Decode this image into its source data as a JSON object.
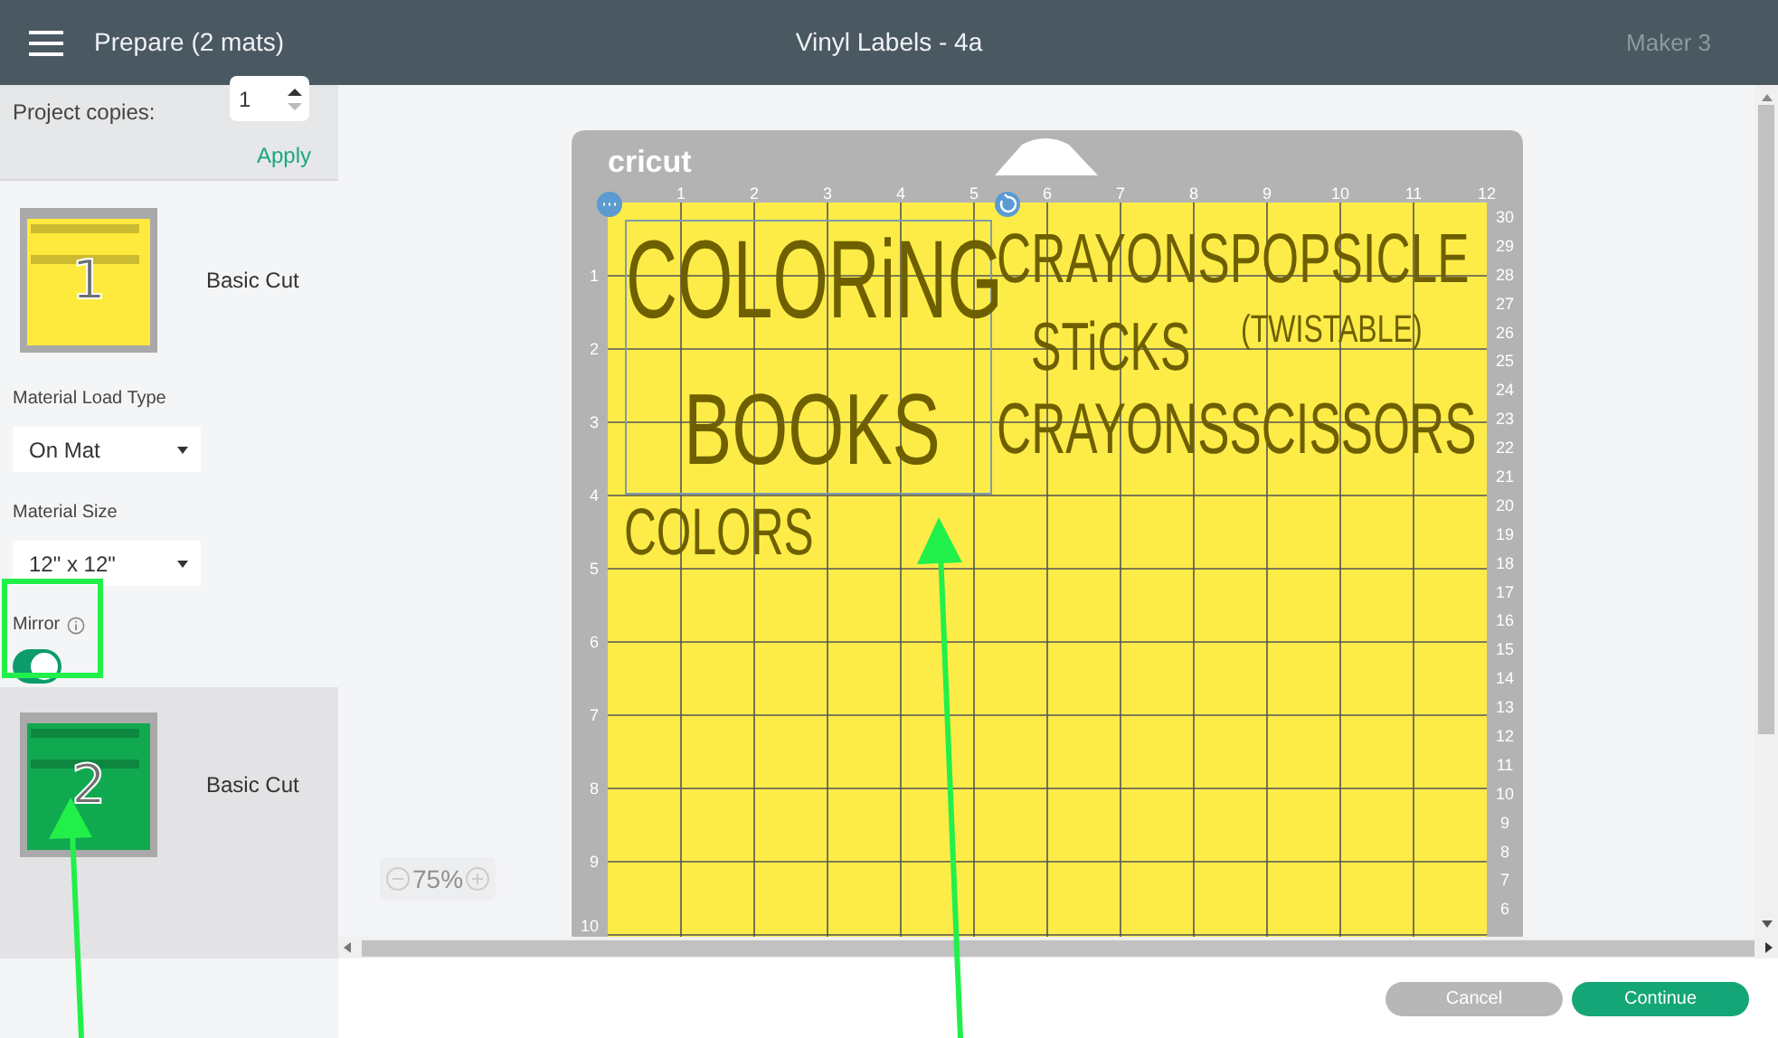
{
  "header": {
    "title": "Prepare (2 mats)",
    "project": "Vinyl Labels - 4a",
    "machine": "Maker 3"
  },
  "copies": {
    "label": "Project copies:",
    "value": "1",
    "apply": "Apply"
  },
  "mats": [
    {
      "number": "1",
      "name": "Basic Cut",
      "color": "#fdea3c",
      "selected": true,
      "settings": {
        "load_type": {
          "label": "Material Load Type",
          "value": "On Mat"
        },
        "size": {
          "label": "Material Size",
          "value": "12\" x 12\""
        },
        "mirror": {
          "label": "Mirror",
          "on": true
        }
      }
    },
    {
      "number": "2",
      "name": "Basic Cut",
      "color": "#11a94f",
      "selected": false
    }
  ],
  "canvas": {
    "logo": "cricut",
    "top_ruler": [
      "1",
      "2",
      "3",
      "4",
      "5",
      "6",
      "7",
      "8",
      "9",
      "10",
      "11",
      "12"
    ],
    "left_ruler": [
      "1",
      "2",
      "3",
      "4",
      "5",
      "6",
      "7",
      "8",
      "9",
      "10"
    ],
    "right_ruler": [
      "30",
      "29",
      "28",
      "27",
      "26",
      "25",
      "24",
      "23",
      "22",
      "21",
      "20",
      "19",
      "18",
      "17",
      "16",
      "15",
      "14",
      "13",
      "12",
      "11",
      "10",
      "9",
      "8",
      "7",
      "6"
    ],
    "designs": [
      {
        "text": "COLORiNG"
      },
      {
        "text": "BOOKS"
      },
      {
        "text": "COLORS"
      },
      {
        "text": "CRAYONSPOPSICLE"
      },
      {
        "text": "STiCKS"
      },
      {
        "text": "(TWISTABLE)"
      },
      {
        "text": "CRAYONSSCISSORS"
      }
    ],
    "zoom": "75%"
  },
  "buttons": [
    {
      "label": "Cancel",
      "kind": "secondary"
    },
    {
      "label": "Continue",
      "kind": "primary"
    }
  ]
}
